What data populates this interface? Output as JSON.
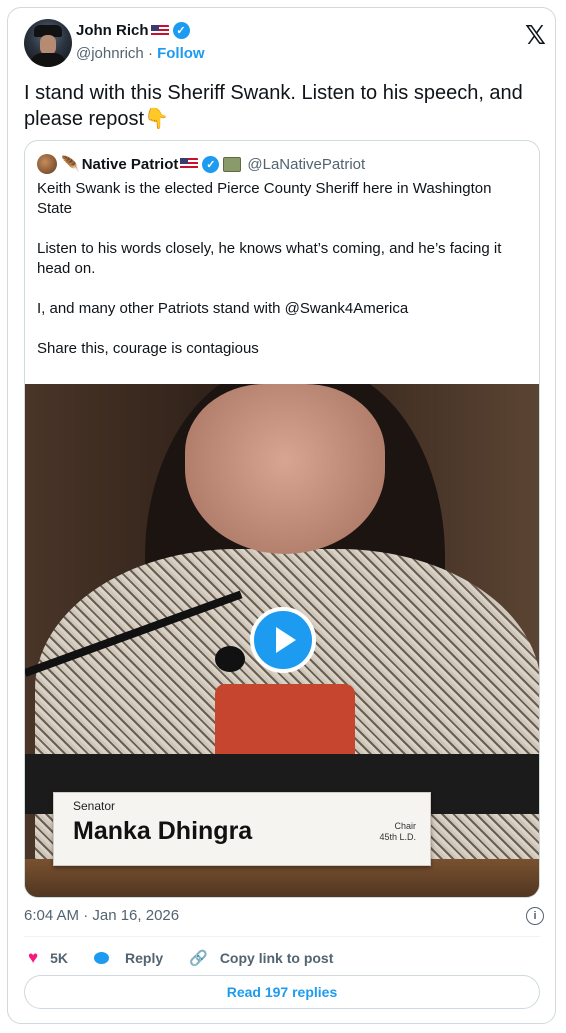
{
  "tweet": {
    "author": {
      "name": "John Rich",
      "handle": "@johnrich",
      "follow_label": "Follow",
      "separator": "·"
    },
    "text": "I stand with this Sheriff Swank. Listen to his speech, and please repost👇",
    "timestamp": "6:04 AM · Jan 16, 2026",
    "info_icon": "i"
  },
  "quote": {
    "author": {
      "name": "Native Patriot",
      "handle": "@LaNativePatriot"
    },
    "paragraphs": [
      "Keith Swank is the elected Pierce County Sheriff here in Washington State",
      "Listen to his words closely, he knows what’s coming, and he’s facing it head on.",
      "I, and many other Patriots stand with @Swank4America",
      "Share this, courage is contagious"
    ],
    "video": {
      "nameplate_title": "Senator",
      "nameplate_name": "Manka Dhingra",
      "nameplate_chair": "Chair",
      "nameplate_district": "45th L.D."
    }
  },
  "actions": {
    "likes": "5K",
    "reply_label": "Reply",
    "copy_label": "Copy link to post",
    "read_replies": "Read 197 replies"
  },
  "colors": {
    "accent": "#1d9bf0",
    "like": "#f91880",
    "muted": "#536471",
    "border": "#cfd9de"
  }
}
